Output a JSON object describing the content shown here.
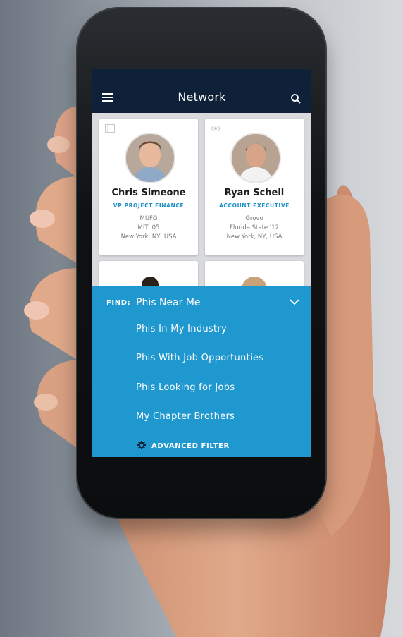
{
  "header": {
    "title": "Network"
  },
  "cards": [
    {
      "name": "Chris Simeone",
      "role": "VP PROJECT FINANCE",
      "company": "MUFG",
      "school": "MIT '05",
      "location": "New York, NY, USA",
      "corner_icon": "bookmark-icon"
    },
    {
      "name": "Ryan Schell",
      "role": "ACCOUNT EXECUTIVE",
      "company": "Grovo",
      "school": "Florida State '12",
      "location": "New York, NY, USA",
      "corner_icon": "eye-icon"
    }
  ],
  "filter_panel": {
    "find_label": "FIND:",
    "selected": "Phis Near Me",
    "options": [
      "Phis In My Industry",
      "Phis With Job Opportunties",
      "Phis Looking for Jobs",
      "My Chapter Brothers"
    ],
    "advanced_label": "ADVANCED FILTER"
  },
  "colors": {
    "topbar": "#0f2138",
    "accent": "#1f97cf",
    "role_text": "#1a8fc8"
  }
}
